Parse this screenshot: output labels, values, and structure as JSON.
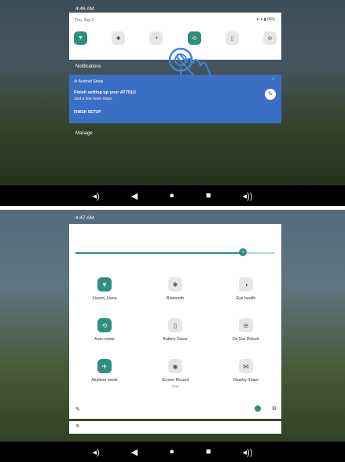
{
  "top": {
    "time": "4:46 AM",
    "date": "Thu, Sep 2",
    "battery": "96%",
    "notifications_label": "Notifications",
    "card": {
      "app": "Android Setup",
      "title": "Finish setting up your AT701U",
      "subtitle": "Just a few more steps",
      "action": "FINISH SETUP"
    },
    "manage_label": "Manage"
  },
  "bottom": {
    "time": "4:47 AM",
    "tiles": [
      {
        "label": "Xiaomi_Hana",
        "icon": "wifi-icon",
        "on": true,
        "sub": ""
      },
      {
        "label": "Bluetooth",
        "icon": "bluetooth-icon",
        "on": false,
        "sub": ""
      },
      {
        "label": "Eye health",
        "icon": "eye-health-icon",
        "on": false,
        "sub": ""
      },
      {
        "label": "Auto-rotate",
        "icon": "rotate-icon",
        "on": true,
        "sub": ""
      },
      {
        "label": "Battery Saver",
        "icon": "battery-icon",
        "on": false,
        "sub": ""
      },
      {
        "label": "Do Not Disturb",
        "icon": "dnd-icon",
        "on": false,
        "sub": ""
      },
      {
        "label": "Airplane mode",
        "icon": "airplane-icon",
        "on": true,
        "sub": ""
      },
      {
        "label": "Screen Record",
        "icon": "record-icon",
        "on": false,
        "sub": "Start"
      },
      {
        "label": "Nearby Share",
        "icon": "nearby-icon",
        "on": false,
        "sub": ""
      }
    ]
  },
  "colors": {
    "accent": "#2f8f7f",
    "card": "#3a6fc4"
  }
}
